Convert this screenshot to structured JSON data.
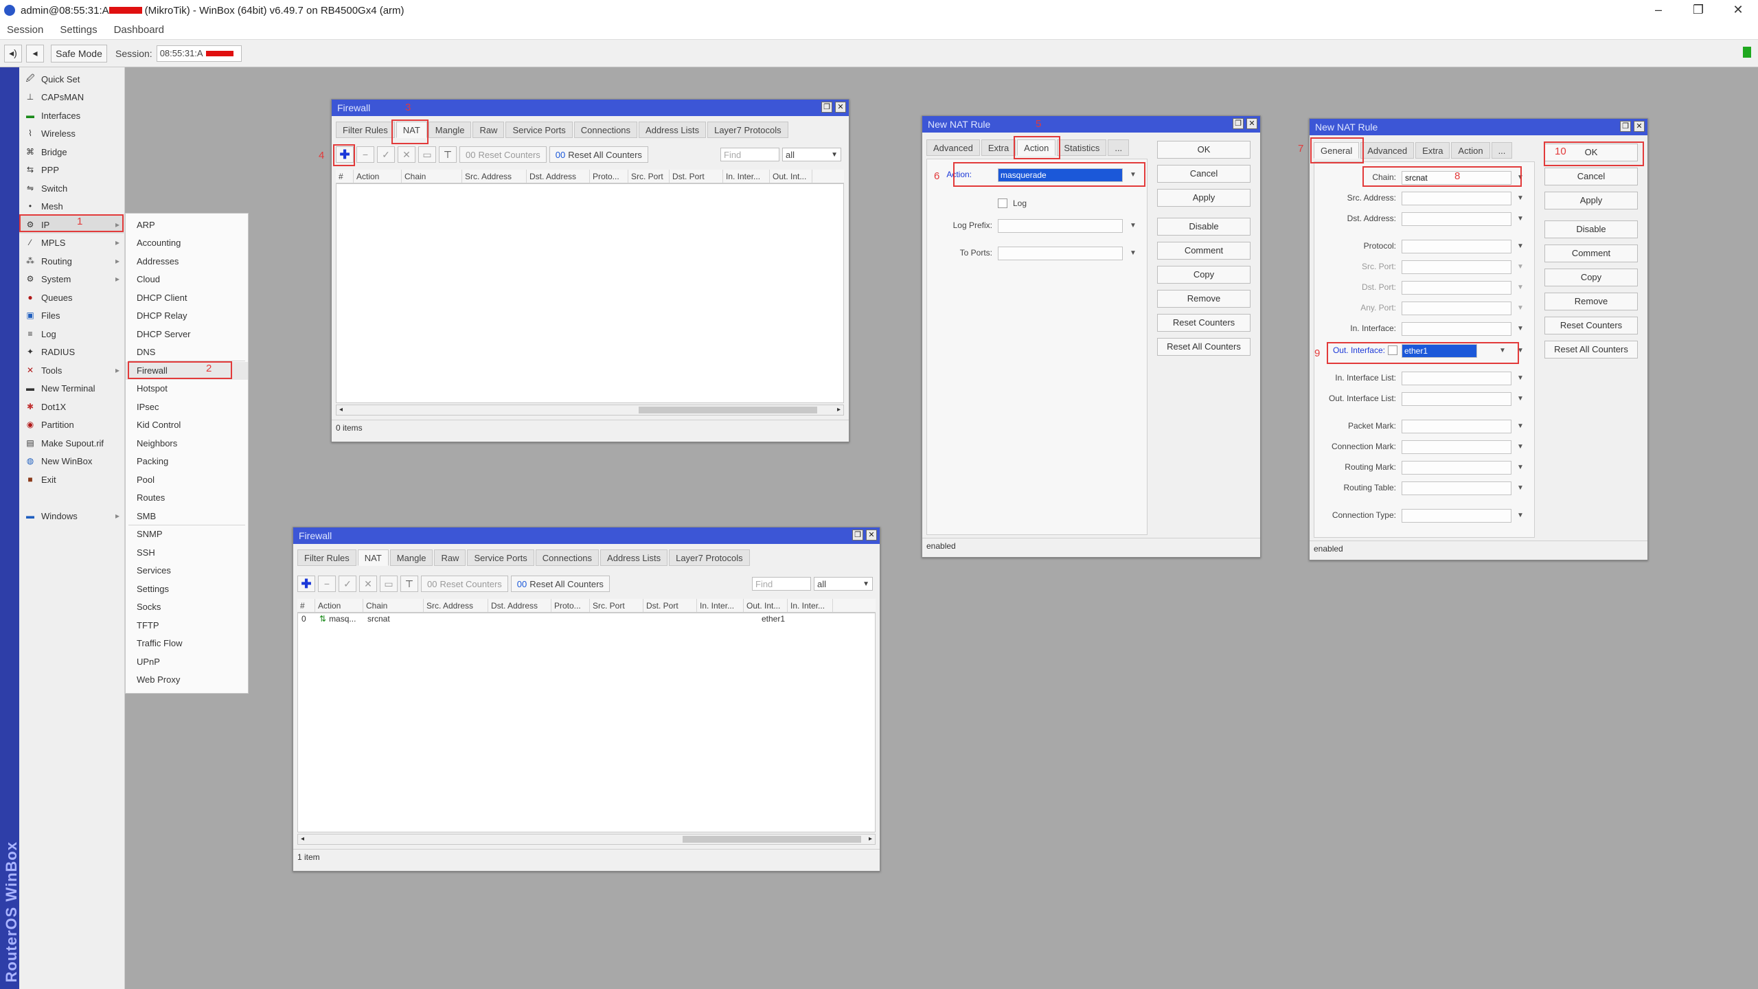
{
  "window": {
    "title": "admin@08:55:31:A",
    "title_rest": "(MikroTik) - WinBox (64bit) v6.49.7 on RB4500Gx4 (arm)",
    "controls": {
      "minimize": "–",
      "maximize": "❐",
      "close": "✕"
    }
  },
  "menubar": [
    "Session",
    "Settings",
    "Dashboard"
  ],
  "toolbar": {
    "back": "◂)",
    "forward": "◂",
    "safe_mode": "Safe Mode",
    "session_label": "Session:",
    "session_value": "08:55:31:A"
  },
  "vertical_brand": "RouterOS WinBox",
  "sidebar": [
    {
      "label": "Quick Set",
      "icon": "🖉"
    },
    {
      "label": "CAPsMAN",
      "icon": "⊥"
    },
    {
      "label": "Interfaces",
      "icon": "▬"
    },
    {
      "label": "Wireless",
      "icon": "⌇"
    },
    {
      "label": "Bridge",
      "icon": "⌘"
    },
    {
      "label": "PPP",
      "icon": "⇆"
    },
    {
      "label": "Switch",
      "icon": "⇋"
    },
    {
      "label": "Mesh",
      "icon": "•"
    },
    {
      "label": "IP",
      "icon": "⚙"
    },
    {
      "label": "MPLS",
      "icon": "⁄"
    },
    {
      "label": "Routing",
      "icon": "⁂"
    },
    {
      "label": "System",
      "icon": "⚙"
    },
    {
      "label": "Queues",
      "icon": "●"
    },
    {
      "label": "Files",
      "icon": "▣"
    },
    {
      "label": "Log",
      "icon": "≡"
    },
    {
      "label": "RADIUS",
      "icon": "✦"
    },
    {
      "label": "Tools",
      "icon": "✕"
    },
    {
      "label": "New Terminal",
      "icon": "▬"
    },
    {
      "label": "Dot1X",
      "icon": "✱"
    },
    {
      "label": "Partition",
      "icon": "◉"
    },
    {
      "label": "Make Supout.rif",
      "icon": "▤"
    },
    {
      "label": "New WinBox",
      "icon": "◍"
    },
    {
      "label": "Exit",
      "icon": "■"
    },
    {
      "label": "Windows",
      "icon": "▬"
    }
  ],
  "ip_submenu": [
    "ARP",
    "Accounting",
    "Addresses",
    "Cloud",
    "DHCP Client",
    "DHCP Relay",
    "DHCP Server",
    "DNS",
    "Firewall",
    "Hotspot",
    "IPsec",
    "Kid Control",
    "Neighbors",
    "Packing",
    "Pool",
    "Routes",
    "SMB",
    "SNMP",
    "SSH",
    "Services",
    "Settings",
    "Socks",
    "TFTP",
    "Traffic Flow",
    "UPnP",
    "Web Proxy"
  ],
  "firewall_tabs": [
    "Filter Rules",
    "NAT",
    "Mangle",
    "Raw",
    "Service Ports",
    "Connections",
    "Address Lists",
    "Layer7 Protocols"
  ],
  "firewall_toolbar": {
    "reset_counters": "Reset Counters",
    "reset_all_counters": "Reset All Counters",
    "find_placeholder": "Find",
    "filter_value": "all"
  },
  "firewall_columns": [
    "#",
    "Action",
    "Chain",
    "Src. Address",
    "Dst. Address",
    "Proto...",
    "Src. Port",
    "Dst. Port",
    "In. Inter...",
    "Out. Int...",
    "In. Inter..."
  ],
  "firewall1": {
    "title": "Firewall",
    "status": "0 items"
  },
  "firewall2": {
    "title": "Firewall",
    "status": "1 item",
    "rows": [
      {
        "num": "0",
        "action": "masq...",
        "chain": "srcnat",
        "out": "ether1"
      }
    ]
  },
  "nat_rule_action": {
    "title": "New NAT Rule",
    "tabs": [
      "Advanced",
      "Extra",
      "Action",
      "Statistics",
      "..."
    ],
    "action_label": "Action:",
    "action_value": "masquerade",
    "log_label": "Log",
    "log_prefix_label": "Log Prefix:",
    "to_ports_label": "To Ports:",
    "status": "enabled"
  },
  "nat_rule_general": {
    "title": "New NAT Rule",
    "tabs": [
      "General",
      "Advanced",
      "Extra",
      "Action",
      "..."
    ],
    "fields": [
      {
        "label": "Chain:",
        "value": "srcnat"
      },
      {
        "label": "Src. Address:",
        "value": ""
      },
      {
        "label": "Dst. Address:",
        "value": ""
      },
      {
        "label": "Protocol:",
        "value": ""
      },
      {
        "label": "Src. Port:",
        "value": ""
      },
      {
        "label": "Dst. Port:",
        "value": ""
      },
      {
        "label": "Any. Port:",
        "value": ""
      },
      {
        "label": "In. Interface:",
        "value": ""
      },
      {
        "label": "Out. Interface:",
        "value": "ether1"
      },
      {
        "label": "In. Interface List:",
        "value": ""
      },
      {
        "label": "Out. Interface List:",
        "value": ""
      },
      {
        "label": "Packet Mark:",
        "value": ""
      },
      {
        "label": "Connection Mark:",
        "value": ""
      },
      {
        "label": "Routing Mark:",
        "value": ""
      },
      {
        "label": "Routing Table:",
        "value": ""
      },
      {
        "label": "Connection Type:",
        "value": ""
      }
    ],
    "status": "enabled"
  },
  "dialog_buttons": [
    "OK",
    "Cancel",
    "Apply",
    "Disable",
    "Comment",
    "Copy",
    "Remove",
    "Reset Counters",
    "Reset All Counters"
  ],
  "step_labels": [
    "1",
    "2",
    "3",
    "4",
    "5",
    "6",
    "7",
    "8",
    "9",
    "10"
  ],
  "colors": {
    "titlebar_blue": "#3c56d6",
    "highlight": "#e23a3a",
    "selection": "#1b58d9"
  }
}
